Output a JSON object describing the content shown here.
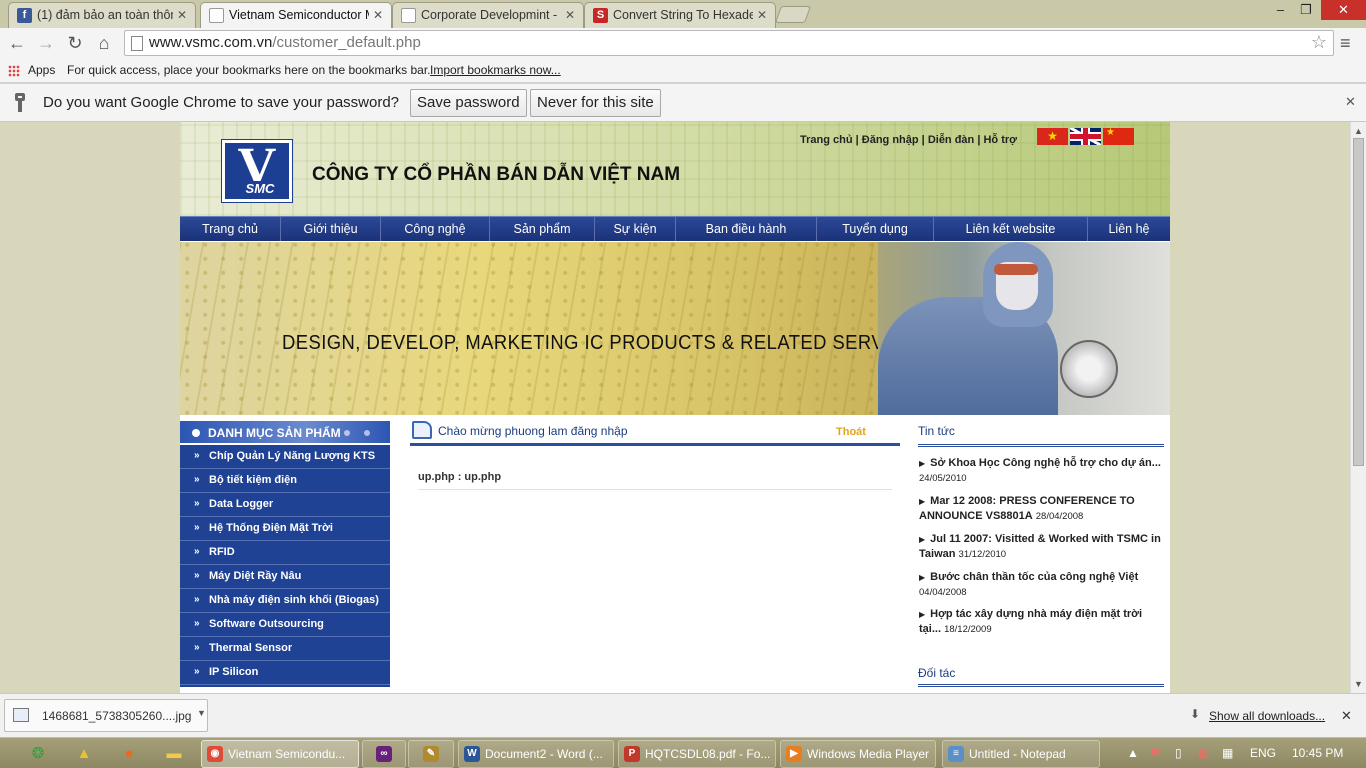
{
  "browser": {
    "tabs": [
      {
        "label": "(1) đảm bảo an toàn thông",
        "icon": "facebook-icon",
        "color": "#3b5998"
      },
      {
        "label": "Vietnam Semiconductor M",
        "icon": "page-icon",
        "color": "#ffffff"
      },
      {
        "label": "Corporate Developmint - ",
        "icon": "page-icon",
        "color": "#ffffff"
      },
      {
        "label": "Convert String To Hexade",
        "icon": "s-icon",
        "color": "#c62828"
      }
    ],
    "url_host": "www.vsmc.com.vn",
    "url_path": "/customer_default.php",
    "bookmarks": {
      "apps": "Apps",
      "hint": "For quick access, place your bookmarks here on the bookmarks bar.",
      "import_link": "Import bookmarks now..."
    },
    "infobar": {
      "question": "Do you want Google Chrome to save your password?",
      "save_btn": "Save password",
      "never_btn": "Never for this site"
    }
  },
  "site": {
    "company_name": "CÔNG TY CỔ PHẦN BÁN DẪN VIỆT NAM",
    "logo_letter": "V",
    "logo_sub": "SMC",
    "top_links": [
      "Trang chủ",
      "Đăng nhập",
      "Diễn đàn",
      "Hỗ trợ"
    ],
    "nav": [
      "Trang chủ",
      "Giới thiệu",
      "Công nghệ",
      "Sản phẩm",
      "Sự kiện",
      "Ban điều hành",
      "Tuyển dụng",
      "Liên kết website",
      "Liên hệ"
    ],
    "banner_tagline": "DESIGN, DEVELOP, MARKETING IC PRODUCTS & RELATED SERVICES",
    "category_title": "DANH MỤC SẢN PHẨM",
    "categories": [
      "Chíp Quản Lý Năng Lượng KTS",
      "Bộ tiết kiệm điện",
      "Data Logger",
      "Hệ Thống Điện Mặt Trời",
      "RFID",
      "Máy Diệt Rầy Nâu",
      "Nhà máy điện sinh khối (Biogas)",
      "Software Outsourcing",
      "Thermal Sensor",
      "IP Silicon"
    ],
    "welcome": "Chào mừng phuong lam đăng nhập",
    "logout": "Thoát",
    "content_text": "up.php : up.php",
    "news_title": "Tin tức",
    "news": [
      {
        "title": "Sở Khoa Học Công nghệ hỗ trợ cho dự án...",
        "date": "24/05/2010"
      },
      {
        "title": "Mar 12 2008: PRESS CONFERENCE TO ANNOUNCE VS8801A",
        "date": "28/04/2008"
      },
      {
        "title": "Jul 11 2007: Visitted & Worked with TSMC in Taiwan",
        "date": "31/12/2010"
      },
      {
        "title": "Bước chân thần tốc của công nghệ Việt",
        "date": "04/04/2008"
      },
      {
        "title": "Hợp tác xây dựng nhà máy điện mặt trời tại...",
        "date": "18/12/2009"
      }
    ],
    "partners_title": "Đối tác"
  },
  "downloads": {
    "file": "1468681_5738305260....jpg",
    "show_all": "Show all downloads..."
  },
  "taskbar": {
    "buttons": [
      {
        "label": "Vietnam Semicondu...",
        "icon": "chrome-icon",
        "color": "#dd4b39"
      },
      {
        "label": "",
        "icon": "visual-studio-icon",
        "color": "#68217a"
      },
      {
        "label": "",
        "icon": "tool-icon",
        "color": "#b08a30"
      },
      {
        "label": "Document2 - Word (...",
        "icon": "word-icon",
        "color": "#2b5797"
      },
      {
        "label": "HQTCSDL08.pdf - Fo...",
        "icon": "pdf-icon",
        "color": "#c0392b"
      },
      {
        "label": "Windows Media Player",
        "icon": "media-player-icon",
        "color": "#e67e22"
      },
      {
        "label": "Untitled - Notepad",
        "icon": "notepad-icon",
        "color": "#5b8fc7"
      }
    ],
    "language": "ENG",
    "time": "10:45 PM"
  }
}
